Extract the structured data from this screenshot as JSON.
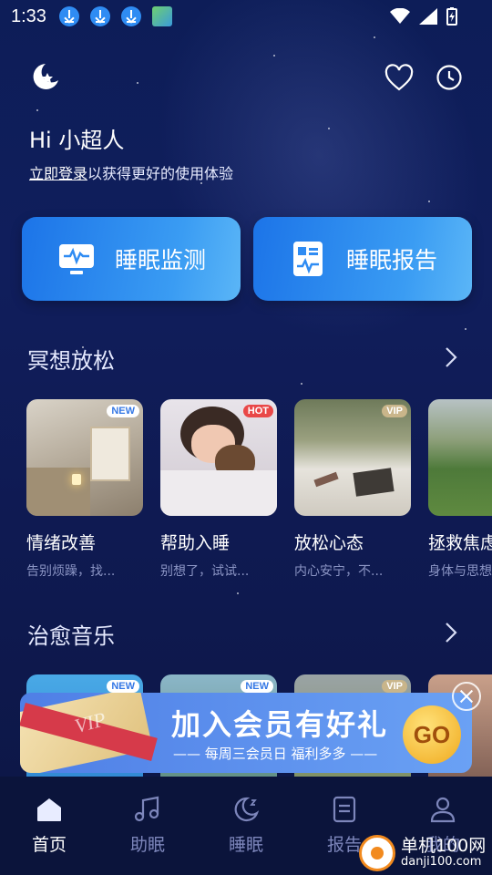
{
  "status_bar": {
    "time": "1:33"
  },
  "header": {
    "greeting": "Hi 小超人",
    "login_link": "立即登录",
    "login_suffix": "以获得更好的使用体验"
  },
  "quick_actions": [
    {
      "label": "睡眠监测",
      "icon": "monitor-pulse-icon"
    },
    {
      "label": "睡眠报告",
      "icon": "report-chart-icon"
    }
  ],
  "meditation": {
    "title": "冥想放松",
    "cards": [
      {
        "title": "情绪改善",
        "desc": "告别烦躁，找...",
        "badge": "NEW"
      },
      {
        "title": "帮助入睡",
        "desc": "别想了，试试...",
        "badge": "HOT"
      },
      {
        "title": "放松心态",
        "desc": "内心安宁，不...",
        "badge": "VIP"
      },
      {
        "title": "拯救焦虑",
        "desc": "身体与思想",
        "badge": ""
      }
    ]
  },
  "music": {
    "title": "治愈音乐",
    "badges": [
      "NEW",
      "NEW",
      "VIP",
      ""
    ]
  },
  "banner": {
    "title": "加入会员有好礼",
    "subtitle": "—— 每周三会员日 福利多多 ——",
    "go": "GO",
    "vip": "VIP"
  },
  "nav": [
    {
      "label": "首页",
      "icon": "home-icon",
      "active": true
    },
    {
      "label": "助眠",
      "icon": "music-note-icon",
      "active": false
    },
    {
      "label": "睡眠",
      "icon": "moon-icon",
      "active": false
    },
    {
      "label": "报告",
      "icon": "document-icon",
      "active": false
    },
    {
      "label": "我的",
      "icon": "user-icon",
      "active": false
    }
  ],
  "watermark": {
    "line1": "单机100网",
    "line2": "danji100.com"
  },
  "colors": {
    "accent": "#2f8cf3",
    "background": "#0f1a52",
    "hot": "#e94848",
    "vip": "#c9b58a"
  }
}
